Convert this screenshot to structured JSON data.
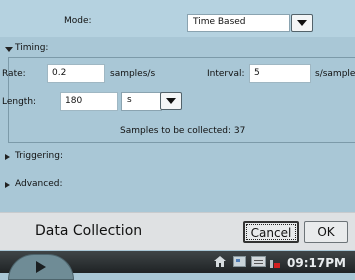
{
  "mode": {
    "label": "Mode:",
    "value": "Time Based"
  },
  "timing": {
    "section_label": "Timing:",
    "rate": {
      "label": "Rate:",
      "value": "0.2",
      "unit": "samples/s"
    },
    "interval": {
      "label": "Interval:",
      "value": "5",
      "unit": "s/sample"
    },
    "length": {
      "label": "Length:",
      "value": "180",
      "unit_value": "s"
    },
    "samples_text": "Samples to be collected: 37"
  },
  "triggering": {
    "label": "Triggering:"
  },
  "advanced": {
    "label": "Advanced:"
  },
  "bottom_bar": {
    "title": "Data Collection",
    "cancel_label": "Cancel",
    "ok_label": "OK"
  },
  "taskbar": {
    "clock": "09:17PM"
  },
  "colors": {
    "background": "#a9c7d6",
    "bar": "#dfe1e3",
    "taskbar": "#2b3032"
  }
}
